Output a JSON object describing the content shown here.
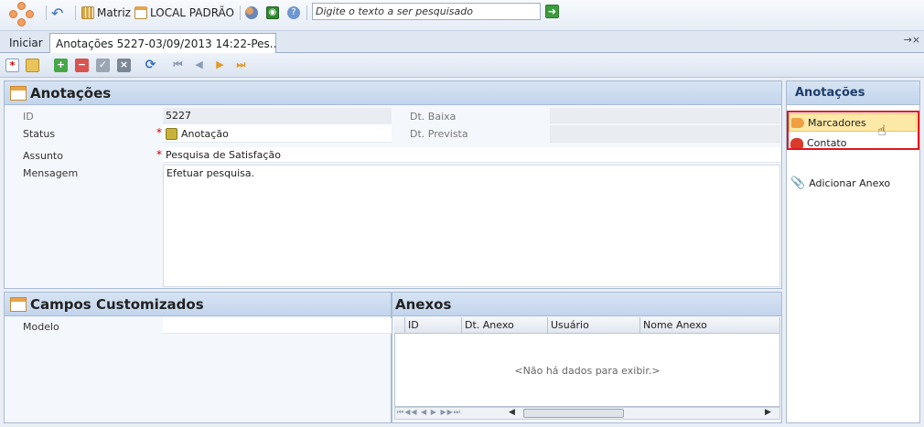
{
  "toolbar": {
    "undo_icon": "undo-icon",
    "company_label": "Matriz",
    "location_label": "LOCAL PADRÃO",
    "search_placeholder": "Digite o texto a ser pesquisado"
  },
  "tabs": {
    "home": "Iniciar",
    "active": "Anotações 5227-03/09/2013 14:22-Pes...",
    "pin_icon": "→×"
  },
  "form": {
    "title": "Anotações",
    "id_label": "ID",
    "id_value": "5227",
    "status_label": "Status",
    "status_value": "Anotação",
    "dt_baixa_label": "Dt. Baixa",
    "dt_prevista_label": "Dt. Prevista",
    "assunto_label": "Assunto",
    "assunto_value": "Pesquisa de Satisfação",
    "mensagem_label": "Mensagem",
    "mensagem_value": "Efetuar pesquisa.",
    "required_mark": "*"
  },
  "custom_fields": {
    "title": "Campos Customizados",
    "modelo_label": "Modelo"
  },
  "attachments": {
    "title": "Anexos",
    "columns": [
      "ID",
      "Dt. Anexo",
      "Usuário",
      "Nome Anexo"
    ],
    "empty_text": "<Não há dados para exibir.>",
    "pager": "⏮◀◀ ◀ ▶ ▶▶⏭"
  },
  "side": {
    "title": "Anotações",
    "items": [
      "Marcadores",
      "Contato",
      "Adicionar Anexo"
    ]
  },
  "colors": {
    "accent": "#1f3e6b",
    "highlight": "#e0141e",
    "item_hover": "#fde9a7"
  }
}
